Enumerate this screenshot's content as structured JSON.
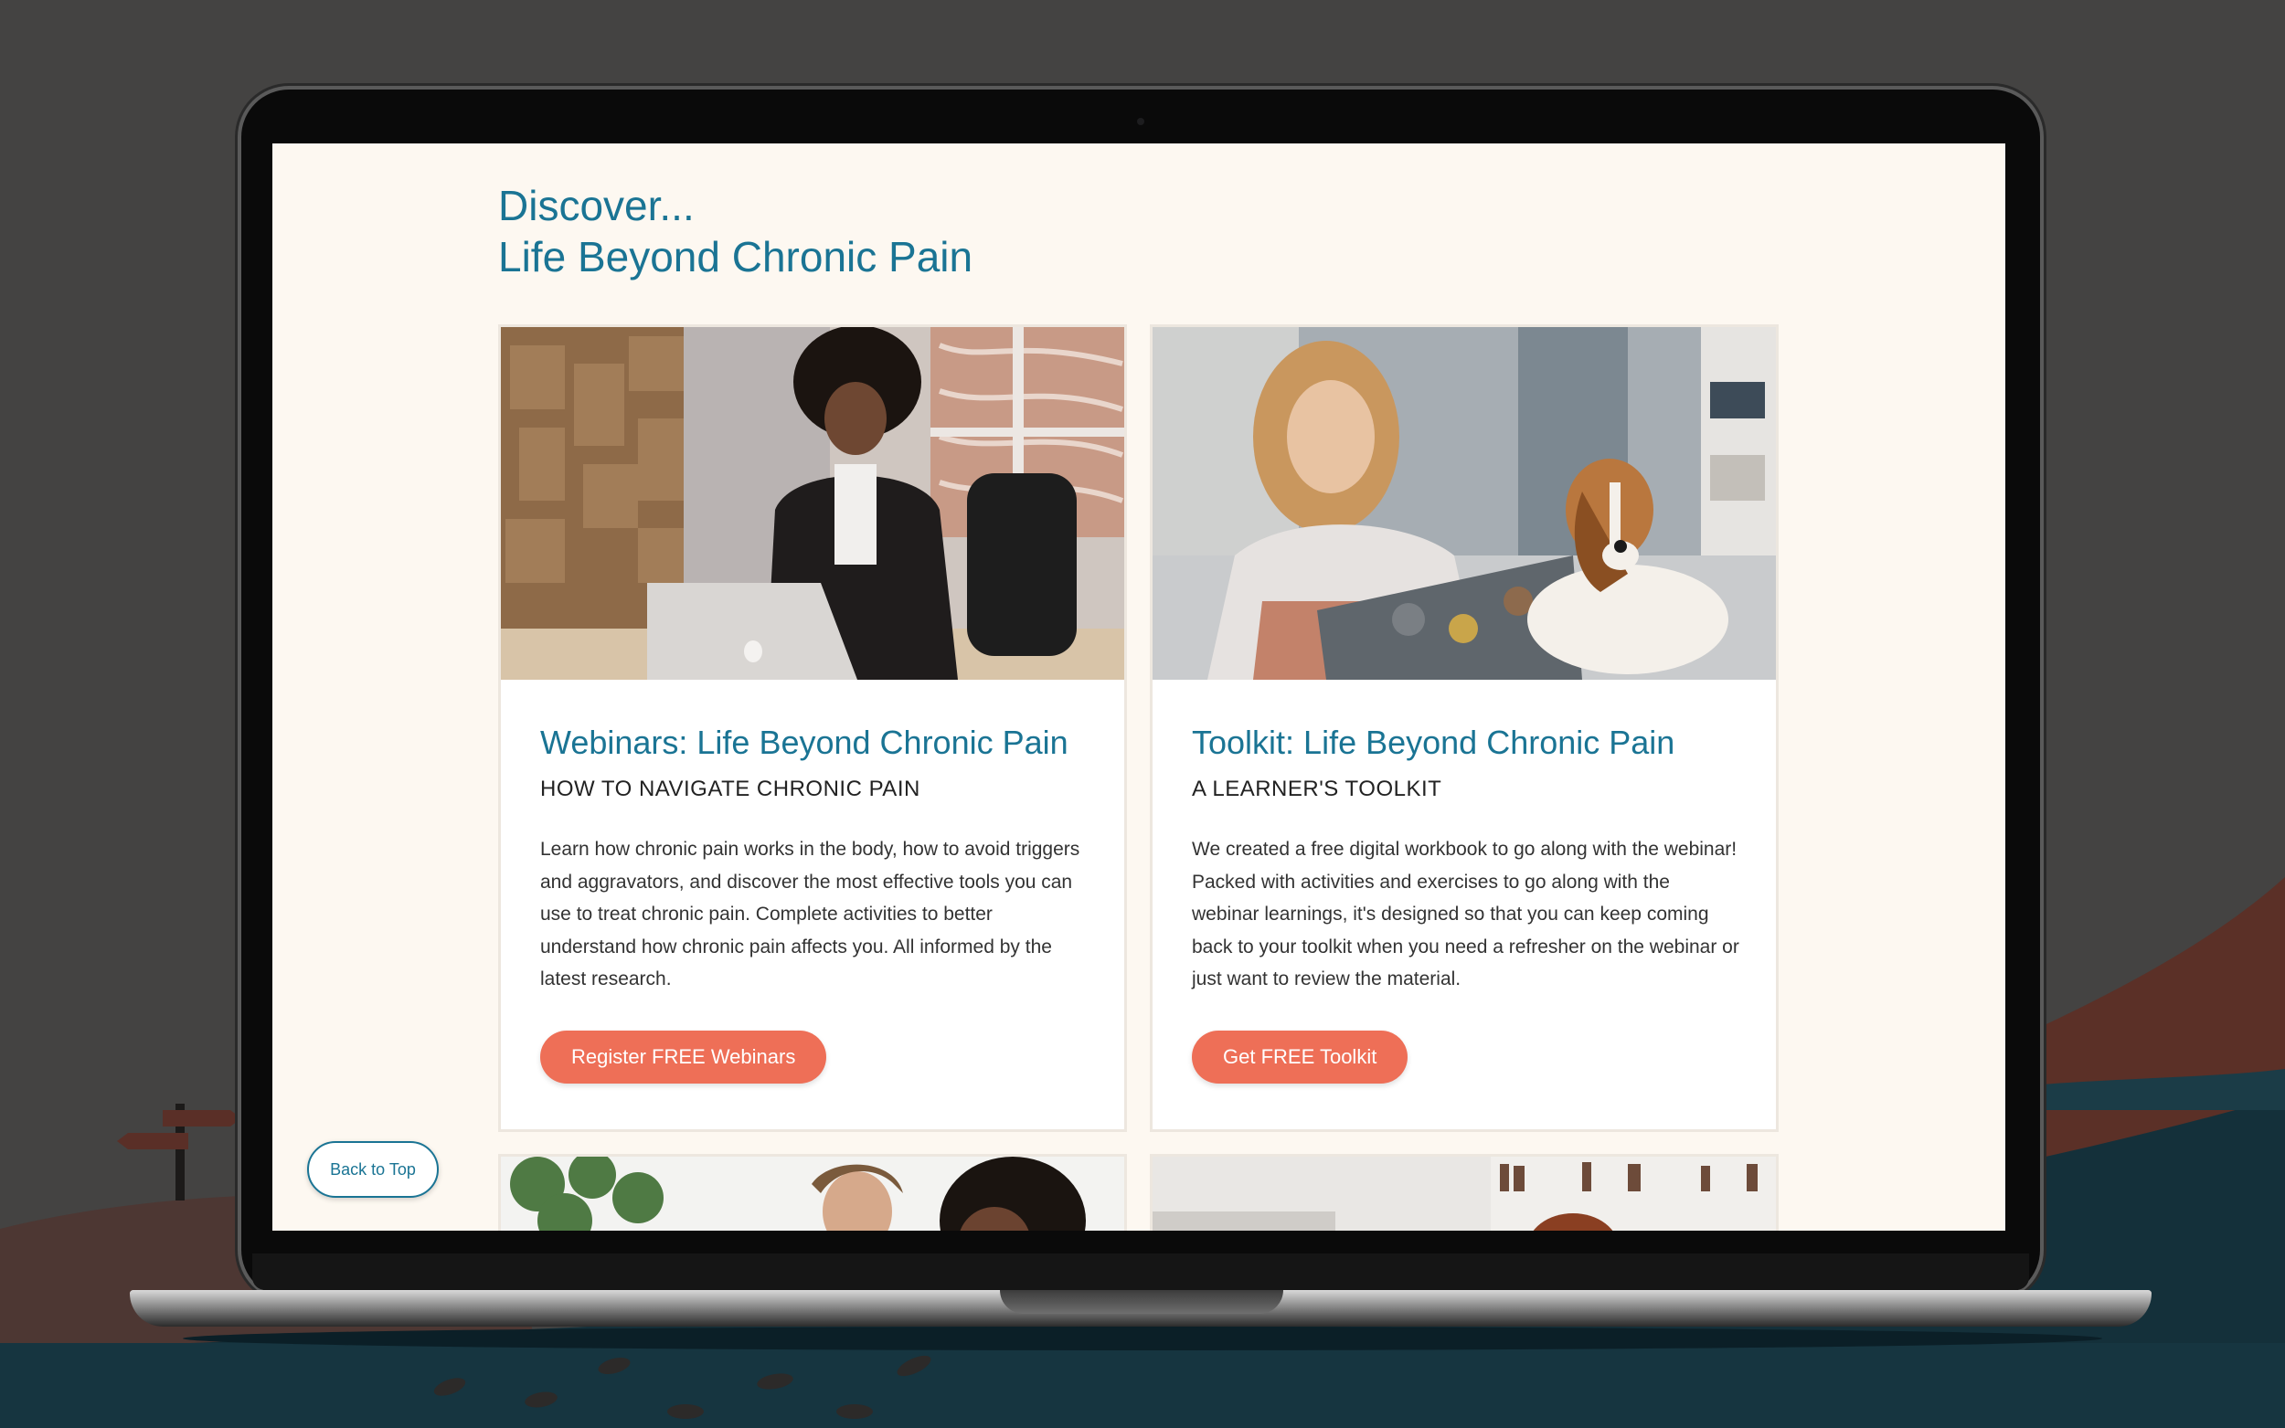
{
  "heading": {
    "line1": "Discover...",
    "line2": "Life Beyond Chronic Pain"
  },
  "cards": [
    {
      "title": "Webinars: Life Beyond Chronic Pain",
      "subtitle": "HOW TO NAVIGATE CHRONIC PAIN",
      "body": "Learn how chronic pain works in the body, how to avoid triggers and aggravators, and discover the most effective tools you can use to treat chronic pain. Complete activities to better understand how chronic pain affects you. All informed by the latest research.",
      "button": "Register FREE Webinars"
    },
    {
      "title": "Toolkit: Life Beyond Chronic Pain",
      "subtitle": "A LEARNER'S TOOLKIT",
      "body": "We created a free digital workbook to go along with the webinar! Packed with activities and exercises to go along with the webinar learnings, it's designed so that you can keep coming back to your toolkit when you need a refresher on the webinar or just want to review the material.",
      "button": "Get FREE Toolkit"
    }
  ],
  "back_to_top": "Back to Top",
  "colors": {
    "accent_teal": "#1a7494",
    "cta_coral": "#ee6f57",
    "page_cream": "#fdf8f1"
  }
}
